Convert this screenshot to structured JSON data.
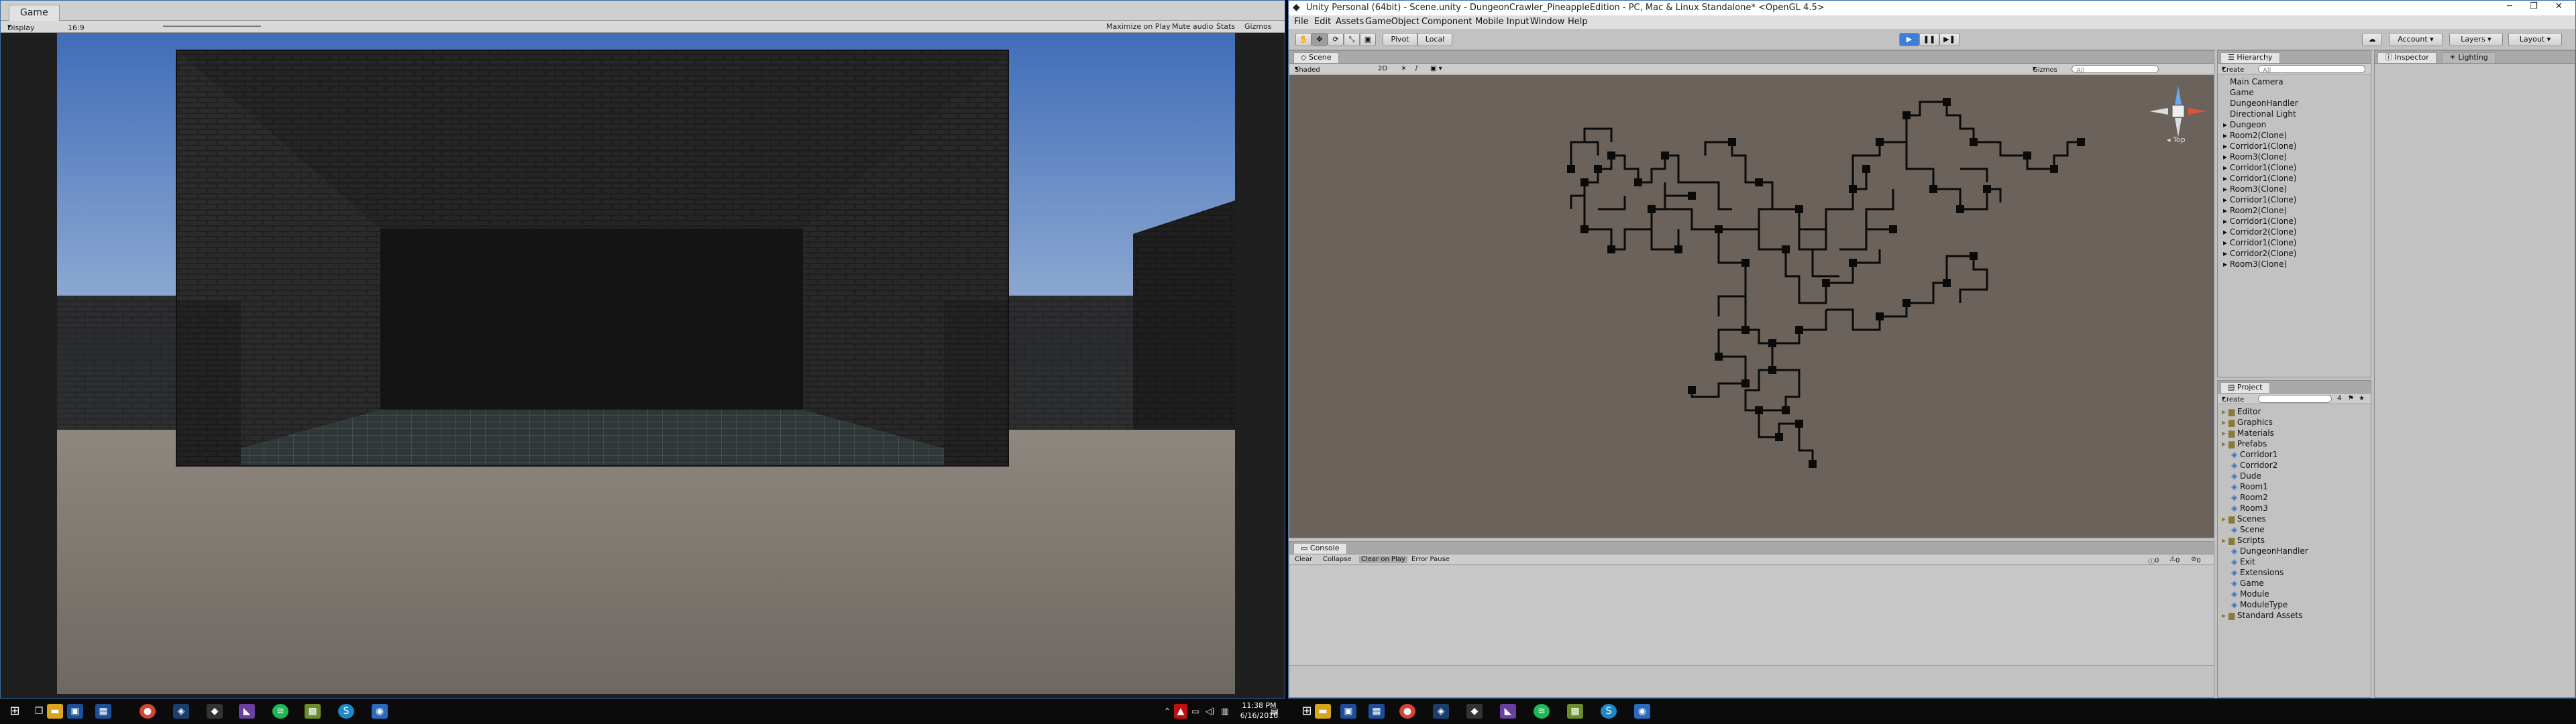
{
  "game_window": {
    "tab_label": "Game",
    "display": "Display 1",
    "aspect": "16:9",
    "maximize_on_play": "Maximize on Play",
    "mute_audio": "Mute audio",
    "stats": "Stats",
    "gizmos": "Gizmos"
  },
  "editor": {
    "title": "Unity Personal (64bit) - Scene.unity - DungeonCrawler_PineappleEdition - PC, Mac & Linux Standalone* <OpenGL 4.5>",
    "menu": [
      "File",
      "Edit",
      "Assets",
      "GameObject",
      "Component",
      "Mobile Input",
      "Window",
      "Help"
    ],
    "toolbar": {
      "pivot": "Pivot",
      "local": "Local",
      "account": "Account",
      "layers": "Layers",
      "layout": "Layout"
    },
    "scene": {
      "tab_label": "Scene",
      "shading": "Shaded",
      "mode_2d": "2D",
      "gizmos": "Gizmos",
      "search_placeholder": "All",
      "orientation_label": "Top"
    },
    "hierarchy": {
      "tab_label": "Hierarchy",
      "create": "Create",
      "search_placeholder": "All",
      "items": [
        "Main Camera",
        "Game",
        "DungeonHandler",
        "Directional Light",
        "Dungeon",
        "Room2(Clone)",
        "Corridor1(Clone)",
        "Room3(Clone)",
        "Corridor1(Clone)",
        "Corridor1(Clone)",
        "Room3(Clone)",
        "Corridor1(Clone)",
        "Room2(Clone)",
        "Corridor1(Clone)",
        "Corridor2(Clone)",
        "Corridor1(Clone)",
        "Corridor2(Clone)",
        "Room3(Clone)"
      ]
    },
    "inspector": {
      "tab_label": "Inspector",
      "lighting_tab": "Lighting"
    },
    "project": {
      "tab_label": "Project",
      "create": "Create",
      "count_badge": "4",
      "items": [
        {
          "label": "Editor",
          "depth": 0
        },
        {
          "label": "Graphics",
          "depth": 0
        },
        {
          "label": "Materials",
          "depth": 0
        },
        {
          "label": "Prefabs",
          "depth": 0
        },
        {
          "label": "Corridor1",
          "depth": 1
        },
        {
          "label": "Corridor2",
          "depth": 1
        },
        {
          "label": "Dude",
          "depth": 1
        },
        {
          "label": "Room1",
          "depth": 1
        },
        {
          "label": "Room2",
          "depth": 1
        },
        {
          "label": "Room3",
          "depth": 1
        },
        {
          "label": "Scenes",
          "depth": 0
        },
        {
          "label": "Scene",
          "depth": 1
        },
        {
          "label": "Scripts",
          "depth": 0
        },
        {
          "label": "DungeonHandler",
          "depth": 1
        },
        {
          "label": "Exit",
          "depth": 1
        },
        {
          "label": "Extensions",
          "depth": 1
        },
        {
          "label": "Game",
          "depth": 1
        },
        {
          "label": "Module",
          "depth": 1
        },
        {
          "label": "ModuleType",
          "depth": 1
        },
        {
          "label": "Standard Assets",
          "depth": 0
        }
      ]
    },
    "console": {
      "tab_label": "Console",
      "clear": "Clear",
      "collapse": "Collapse",
      "clear_on_play": "Clear on Play",
      "error_pause": "Error Pause",
      "count_info": "0",
      "count_warn": "0",
      "count_error": "0"
    }
  },
  "taskbar": {
    "time": "11:38 PM",
    "date": "6/16/2016"
  },
  "colors": {
    "unity_bg": "#c2c2c2",
    "scene_bg": "#6b625b",
    "play_blue": "#3b7fd9",
    "sky_top": "#3f6db8",
    "floor": "#7c766f"
  }
}
